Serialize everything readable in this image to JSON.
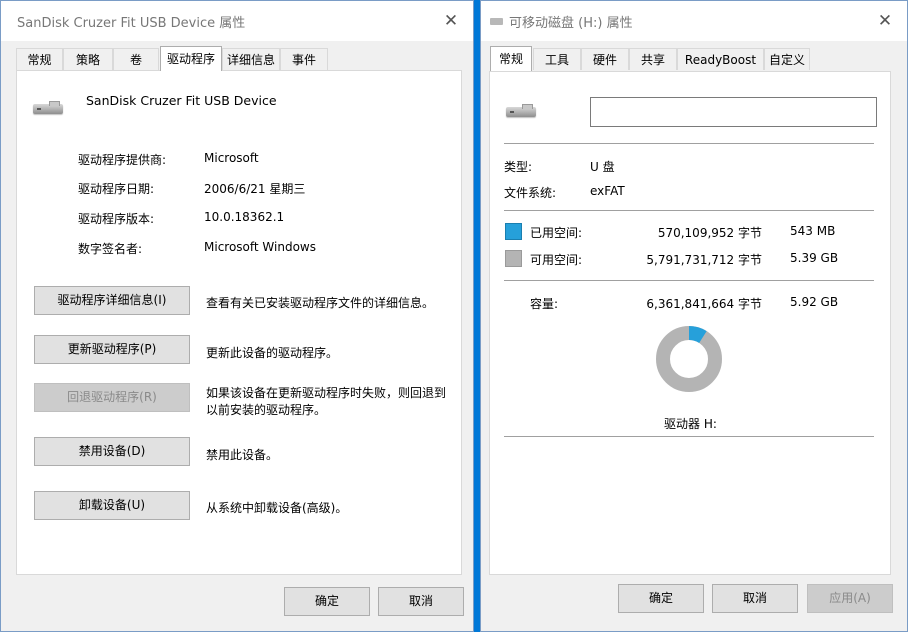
{
  "left": {
    "title": "SanDisk Cruzer Fit USB Device 属性",
    "close_glyph": "✕",
    "tabs": [
      "常规",
      "策略",
      "卷",
      "驱动程序",
      "详细信息",
      "事件"
    ],
    "device_name": "SanDisk Cruzer Fit USB Device",
    "props": [
      {
        "label": "驱动程序提供商:",
        "value": "Microsoft"
      },
      {
        "label": "驱动程序日期:",
        "value": "2006/6/21 星期三"
      },
      {
        "label": "驱动程序版本:",
        "value": "10.0.18362.1"
      },
      {
        "label": "数字签名者:",
        "value": "Microsoft Windows"
      }
    ],
    "actions": [
      {
        "button": "驱动程序详细信息(I)",
        "desc": "查看有关已安装驱动程序文件的详细信息。",
        "enabled": true
      },
      {
        "button": "更新驱动程序(P)",
        "desc": "更新此设备的驱动程序。",
        "enabled": true
      },
      {
        "button": "回退驱动程序(R)",
        "desc": "如果该设备在更新驱动程序时失败，则回退到以前安装的驱动程序。",
        "desc_line1": "如果该设备在更新驱动程序时失败，则回退到",
        "desc_line2": "以前安装的驱动程序。",
        "enabled": false
      },
      {
        "button": "禁用设备(D)",
        "desc": "禁用此设备。",
        "enabled": true
      },
      {
        "button": "卸载设备(U)",
        "desc": "从系统中卸载设备(高级)。",
        "enabled": true
      }
    ],
    "ok": "确定",
    "cancel": "取消"
  },
  "right": {
    "title": "可移动磁盘 (H:) 属性",
    "close_glyph": "✕",
    "tabs": [
      "常规",
      "工具",
      "硬件",
      "共享",
      "ReadyBoost",
      "自定义"
    ],
    "name_value": "",
    "type_label": "类型:",
    "type_value": "U 盘",
    "fs_label": "文件系统:",
    "fs_value": "exFAT",
    "used": {
      "label": "已用空间:",
      "bytes": "570,109,952 字节",
      "size": "543 MB"
    },
    "free": {
      "label": "可用空间:",
      "bytes": "5,791,731,712 字节",
      "size": "5.39 GB"
    },
    "capacity": {
      "label": "容量:",
      "bytes": "6,361,841,664 字节",
      "size": "5.92 GB"
    },
    "usage": {
      "used_bytes": 570109952,
      "total_bytes": 6361841664
    },
    "drive_label": "驱动器 H:",
    "ok": "确定",
    "cancel": "取消",
    "apply": "应用(A)"
  },
  "colors": {
    "used": "#26a0da",
    "free": "#b4b4b4"
  }
}
